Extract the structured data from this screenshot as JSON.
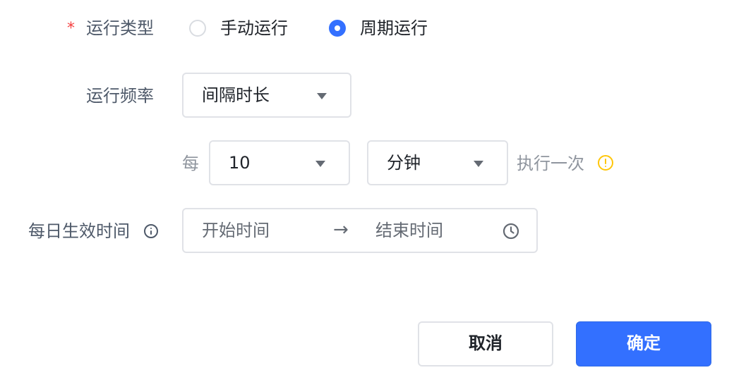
{
  "form": {
    "run_type": {
      "required_mark": "*",
      "label": "运行类型",
      "options": [
        {
          "label": "手动运行",
          "checked": false
        },
        {
          "label": "周期运行",
          "checked": true
        }
      ]
    },
    "frequency": {
      "label": "运行频率",
      "value": "间隔时长"
    },
    "interval": {
      "prefix": "每",
      "amount": "10",
      "unit": "分钟",
      "suffix": "执行一次"
    },
    "effective_time": {
      "label": "每日生效时间",
      "start_placeholder": "开始时间",
      "arrow": "→",
      "end_placeholder": "结束时间"
    }
  },
  "footer": {
    "cancel_label": "取消",
    "confirm_label": "确定"
  },
  "colors": {
    "primary": "#3370ff",
    "required": "#f53f3f",
    "warning": "#ffc60a",
    "border": "#e0e2e7"
  }
}
